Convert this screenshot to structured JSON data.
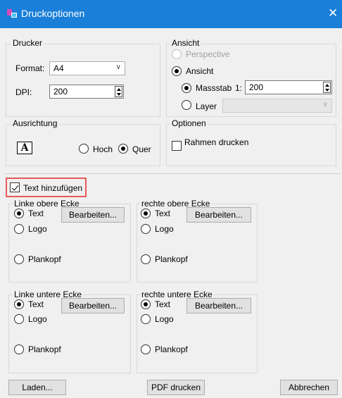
{
  "window": {
    "title": "Druckoptionen"
  },
  "drucker": {
    "group_label": "Drucker",
    "format_label": "Format:",
    "format_value": "A4",
    "dpi_label": "DPI:",
    "dpi_value": "200"
  },
  "ansicht": {
    "group_label": "Ansicht",
    "perspective_label": "Perspective",
    "ansicht_label": "Ansicht",
    "massstab_label": "Massstab",
    "massstab_prefix": "1:",
    "massstab_value": "200",
    "layer_label": "Layer",
    "layer_value": ""
  },
  "ausrichtung": {
    "group_label": "Ausrichtung",
    "icon_glyph": "A",
    "hoch_label": "Hoch",
    "quer_label": "Quer",
    "selected": "Quer"
  },
  "optionen": {
    "group_label": "Optionen",
    "rahmen_label": "Rahmen drucken",
    "rahmen_checked": false
  },
  "text_hinzufuegen": {
    "label": "Text hinzufügen",
    "checked": true
  },
  "corners": {
    "top_left": {
      "label": "Linke obere Ecke",
      "text": "Text",
      "logo": "Logo",
      "plankopf": "Plankopf",
      "edit": "Bearbeiten...",
      "selected": "Text"
    },
    "top_right": {
      "label": "rechte obere Ecke",
      "text": "Text",
      "logo": "Logo",
      "plankopf": "Plankopf",
      "edit": "Bearbeiten...",
      "selected": "Text"
    },
    "bottom_left": {
      "label": "Linke untere Ecke",
      "text": "Text",
      "logo": "Logo",
      "plankopf": "Plankopf",
      "edit": "Bearbeiten...",
      "selected": "Text"
    },
    "bottom_right": {
      "label": "rechte untere Ecke",
      "text": "Text",
      "logo": "Logo",
      "plankopf": "Plankopf",
      "edit": "Bearbeiten...",
      "selected": "Text"
    }
  },
  "footer": {
    "laden": "Laden...",
    "pdf": "PDF drucken",
    "abbrechen": "Abbrechen"
  },
  "colors": {
    "titlebar": "#1a7fd8",
    "highlight": "#e85a5a",
    "background": "#f0f0f0"
  }
}
